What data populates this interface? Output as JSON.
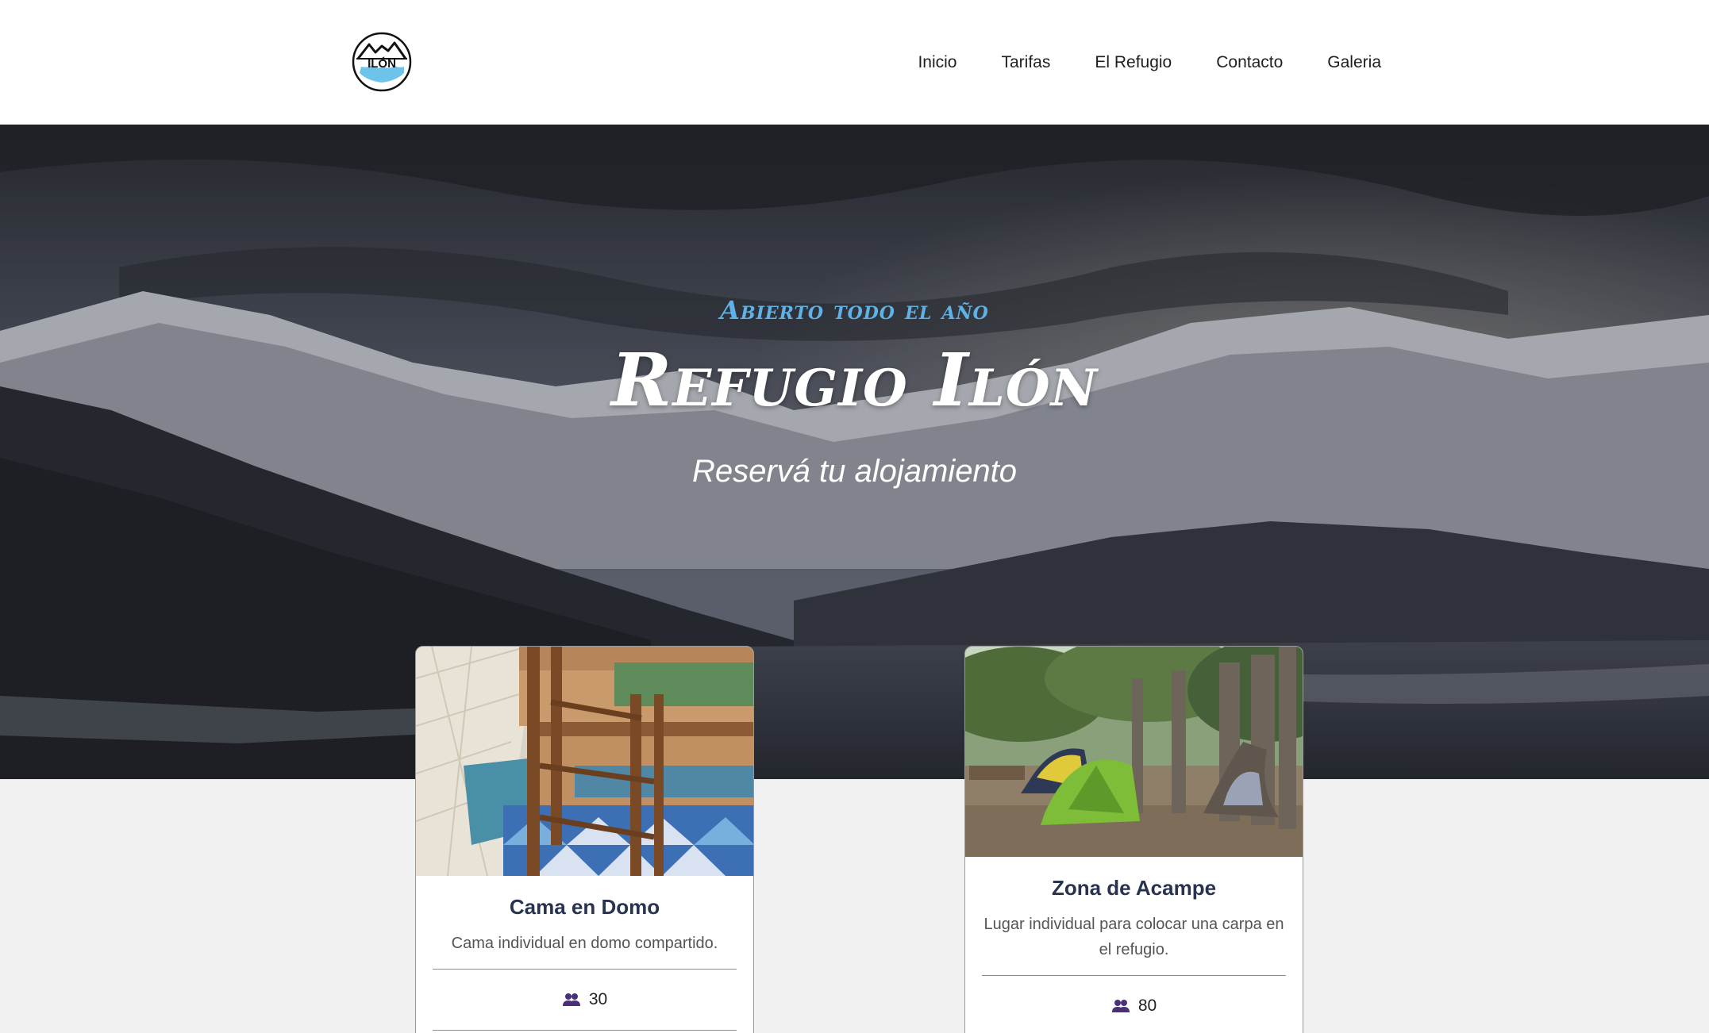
{
  "header": {
    "logo_text": "ILÓN",
    "nav": [
      "Inicio",
      "Tarifas",
      "El Refugio",
      "Contacto",
      "Galeria"
    ]
  },
  "hero": {
    "eyebrow": "Abierto todo el año",
    "title": "Refugio Ilón",
    "subtitle": "Reservá tu alojamiento"
  },
  "cards": [
    {
      "title": "Cama en Domo",
      "description": "Cama individual en domo compartido.",
      "capacity_icon": "people-icon",
      "capacity": "30"
    },
    {
      "title": "Zona de Acampe",
      "description": "Lugar individual para colocar una carpa en el refugio.",
      "capacity_icon": "people-icon",
      "capacity": "80"
    }
  ],
  "colors": {
    "eyebrow": "#5fb2e6",
    "card_title": "#283350",
    "icon": "#4a2f7a",
    "page_bg": "#f1f1f1"
  }
}
